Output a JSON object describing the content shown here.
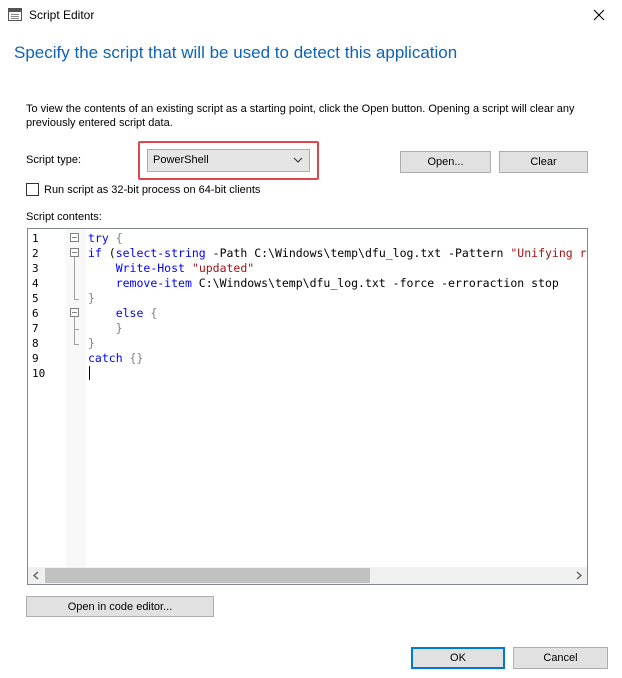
{
  "window": {
    "title": "Script Editor",
    "icon": "script-editor-icon",
    "close_icon": "close-icon"
  },
  "heading": "Specify the script that will be used to detect this application",
  "intro": "To view the contents of an existing script as a starting point, click the Open button. Opening a script will clear any previously entered script data.",
  "script_type": {
    "label": "Script type:",
    "selected": "PowerShell"
  },
  "buttons": {
    "open": "Open...",
    "clear": "Clear",
    "open_code_editor": "Open in code editor...",
    "ok": "OK",
    "cancel": "Cancel"
  },
  "checkbox": {
    "label": "Run script as 32-bit process on 64-bit clients",
    "checked": false
  },
  "script_contents_label": "Script contents:",
  "editor": {
    "line_numbers": [
      "1",
      "2",
      "3",
      "4",
      "5",
      "6",
      "7",
      "8",
      "9",
      "10"
    ],
    "lines": [
      [
        {
          "t": "try",
          "c": "kw"
        },
        {
          "t": " {",
          "c": "brace"
        }
      ],
      [
        {
          "t": "if",
          "c": "kw"
        },
        {
          "t": " (",
          "c": "txt"
        },
        {
          "t": "select-string",
          "c": "cmd"
        },
        {
          "t": " -Path C:\\Windows\\temp\\dfu_log.txt -Pattern ",
          "c": "txt"
        },
        {
          "t": "\"Unifying r",
          "c": "str"
        }
      ],
      [
        {
          "t": "    ",
          "c": "txt"
        },
        {
          "t": "Write-Host",
          "c": "cmd"
        },
        {
          "t": " ",
          "c": "txt"
        },
        {
          "t": "\"updated\"",
          "c": "str"
        }
      ],
      [
        {
          "t": "    ",
          "c": "txt"
        },
        {
          "t": "remove-item",
          "c": "cmd"
        },
        {
          "t": " C:\\Windows\\temp\\dfu_log.txt -force -erroraction stop",
          "c": "txt"
        }
      ],
      [
        {
          "t": "}",
          "c": "brace"
        }
      ],
      [
        {
          "t": "    ",
          "c": "txt"
        },
        {
          "t": "else",
          "c": "kw"
        },
        {
          "t": " {",
          "c": "brace"
        }
      ],
      [
        {
          "t": "    ",
          "c": "txt"
        },
        {
          "t": "}",
          "c": "brace"
        }
      ],
      [
        {
          "t": "}",
          "c": "brace"
        }
      ],
      [
        {
          "t": "catch",
          "c": "kw"
        },
        {
          "t": " {}",
          "c": "brace"
        }
      ],
      []
    ]
  },
  "colors": {
    "heading": "#0e63b8",
    "highlight": "#e0474c",
    "keyword": "#0000ff",
    "string": "#a31515"
  }
}
